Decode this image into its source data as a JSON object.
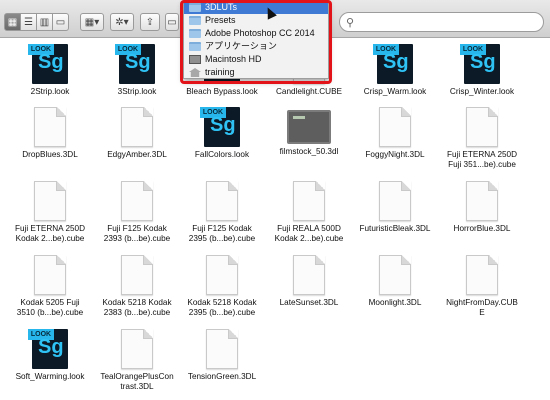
{
  "search": {
    "placeholder": ""
  },
  "popup": {
    "items": [
      {
        "label": "3DLUTs",
        "icon": "folder-icon",
        "selected": true
      },
      {
        "label": "Presets",
        "icon": "folder-icon"
      },
      {
        "label": "Adobe Photoshop CC 2014",
        "icon": "folder-icon"
      },
      {
        "label": "アプリケーション",
        "icon": "folder-icon"
      },
      {
        "label": "Macintosh HD",
        "icon": "hard-drive-icon"
      },
      {
        "label": "training",
        "icon": "home-icon"
      }
    ]
  },
  "files": [
    {
      "name": "2Strip.look",
      "type": "look"
    },
    {
      "name": "3Strip.look",
      "type": "look"
    },
    {
      "name": "Bleach Bypass.look",
      "type": "look"
    },
    {
      "name": "Candlelight.CUBE",
      "type": "doc"
    },
    {
      "name": "Crisp_Warm.look",
      "type": "look"
    },
    {
      "name": "Crisp_Winter.look",
      "type": "look"
    },
    {
      "name": "DropBlues.3DL",
      "type": "doc"
    },
    {
      "name": "EdgyAmber.3DL",
      "type": "doc"
    },
    {
      "name": "FallColors.look",
      "type": "look"
    },
    {
      "name": "filmstock_50.3dl",
      "type": "cube"
    },
    {
      "name": "FoggyNight.3DL",
      "type": "doc"
    },
    {
      "name": "Fuji ETERNA 250D\nFuji 351...be).cube",
      "type": "doc"
    },
    {
      "name": "Fuji ETERNA 250D\nKodak 2...be).cube",
      "type": "doc"
    },
    {
      "name": "Fuji F125 Kodak\n2393 (b...be).cube",
      "type": "doc"
    },
    {
      "name": "Fuji F125 Kodak\n2395 (b...be).cube",
      "type": "doc"
    },
    {
      "name": "Fuji REALA 500D\nKodak 2...be).cube",
      "type": "doc"
    },
    {
      "name": "FuturisticBleak.3DL",
      "type": "doc"
    },
    {
      "name": "HorrorBlue.3DL",
      "type": "doc"
    },
    {
      "name": "Kodak 5205 Fuji\n3510 (b...be).cube",
      "type": "doc"
    },
    {
      "name": "Kodak 5218 Kodak\n2383 (b...be).cube",
      "type": "doc"
    },
    {
      "name": "Kodak 5218 Kodak\n2395 (b...be).cube",
      "type": "doc"
    },
    {
      "name": "LateSunset.3DL",
      "type": "doc"
    },
    {
      "name": "Moonlight.3DL",
      "type": "doc"
    },
    {
      "name": "NightFromDay.CUB\nE",
      "type": "doc"
    },
    {
      "name": "Soft_Warming.look",
      "type": "look"
    },
    {
      "name": "TealOrangePlusCon\ntrast.3DL",
      "type": "doc"
    },
    {
      "name": "TensionGreen.3DL",
      "type": "doc"
    }
  ]
}
